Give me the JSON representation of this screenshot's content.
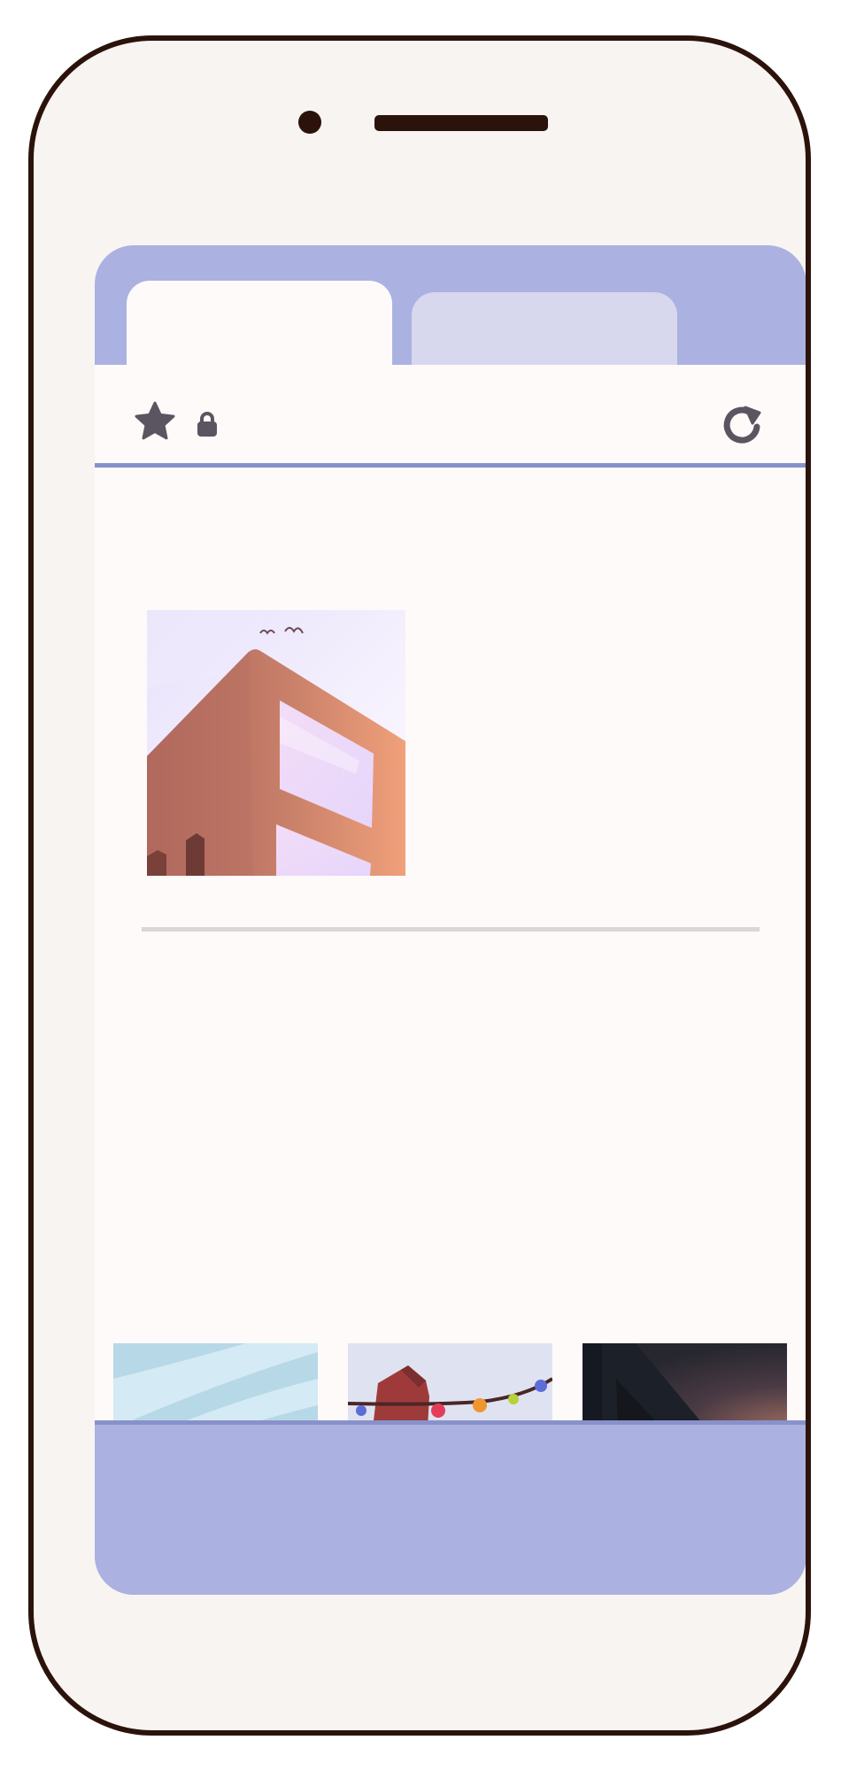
{
  "device": {
    "type": "smartphone",
    "frame_color": "#2b130c",
    "screen_color": "#f8f4f1"
  },
  "browser": {
    "accent_color": "#abb2e1",
    "divider_color": "#8891cb",
    "tabs": [
      {
        "state": "active"
      },
      {
        "state": "inactive"
      }
    ],
    "toolbar": {
      "icons": [
        "star-icon",
        "lock-icon",
        "reload-icon"
      ]
    }
  },
  "page": {
    "hero_image": "building-illustration",
    "thumbnails": [
      "sky-thumbnail",
      "string-lights-thumbnail",
      "dark-night-thumbnail"
    ]
  }
}
